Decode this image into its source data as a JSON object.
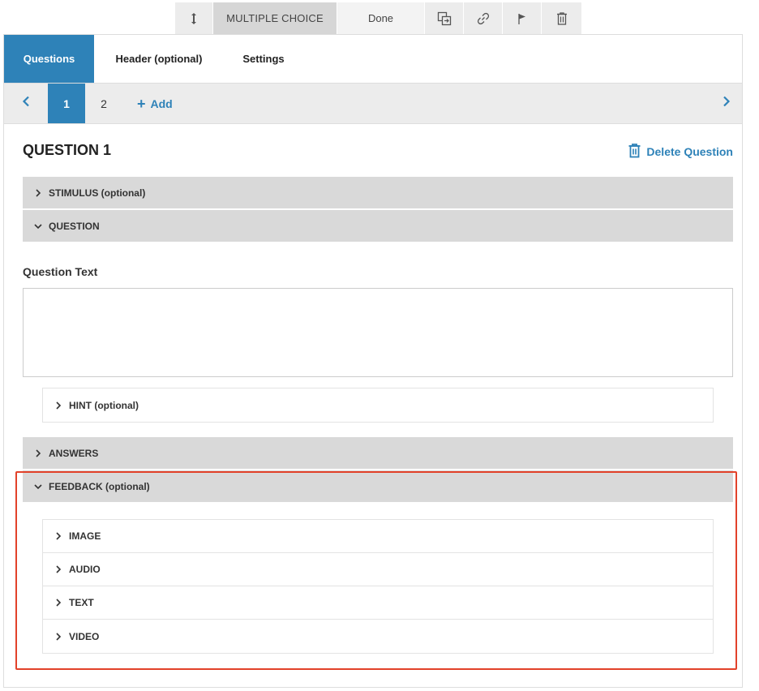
{
  "toolbar": {
    "move_icon": "vertical-resize-icon",
    "question_type": "MULTIPLE CHOICE",
    "done_label": "Done",
    "icons": [
      "duplicate-icon",
      "link-icon",
      "flag-icon",
      "trash-icon"
    ]
  },
  "tabs": {
    "questions": "Questions",
    "header": "Header (optional)",
    "settings": "Settings"
  },
  "qnav": {
    "numbers": [
      "1",
      "2"
    ],
    "add_label": "Add"
  },
  "question": {
    "title": "QUESTION 1",
    "delete_label": "Delete Question",
    "stimulus": "STIMULUS (optional)",
    "question_section": "QUESTION",
    "text_label": "Question Text",
    "text_value": "",
    "hint": "HINT (optional)",
    "answers": "ANSWERS",
    "feedback": "FEEDBACK (optional)",
    "feedback_items": [
      "IMAGE",
      "AUDIO",
      "TEXT",
      "VIDEO"
    ]
  },
  "colors": {
    "accent": "#2e82b8",
    "highlight": "#e2422a",
    "section_bg": "#d9d9d9"
  }
}
